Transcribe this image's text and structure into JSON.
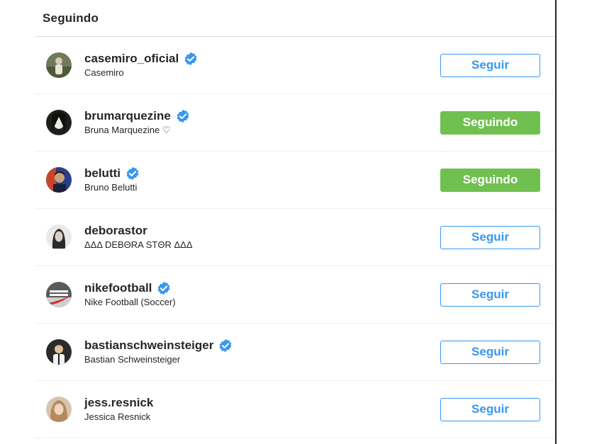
{
  "header": {
    "title": "Seguindo"
  },
  "colors": {
    "accent": "#3897f0",
    "following_bg": "#70c050",
    "verified": "#3897f0"
  },
  "rows": [
    {
      "username": "casemiro_oficial",
      "fullname": "Casemiro",
      "verified": true,
      "button": "Seguir",
      "state": "follow"
    },
    {
      "username": "brumarquezine",
      "fullname": "Bruna Marquezine ♡",
      "verified": true,
      "button": "Seguindo",
      "state": "following"
    },
    {
      "username": "belutti",
      "fullname": "Bruno Belutti",
      "verified": true,
      "button": "Seguindo",
      "state": "following"
    },
    {
      "username": "deborastor",
      "fullname": "ΔΔΔ DEBΘRA STΘR ΔΔΔ",
      "verified": false,
      "button": "Seguir",
      "state": "follow"
    },
    {
      "username": "nikefootball",
      "fullname": "Nike Football (Soccer)",
      "verified": true,
      "button": "Seguir",
      "state": "follow"
    },
    {
      "username": "bastianschweinsteiger",
      "fullname": "Bastian Schweinsteiger",
      "verified": true,
      "button": "Seguir",
      "state": "follow"
    },
    {
      "username": "jess.resnick",
      "fullname": "Jessica Resnick",
      "verified": false,
      "button": "Seguir",
      "state": "follow"
    }
  ]
}
